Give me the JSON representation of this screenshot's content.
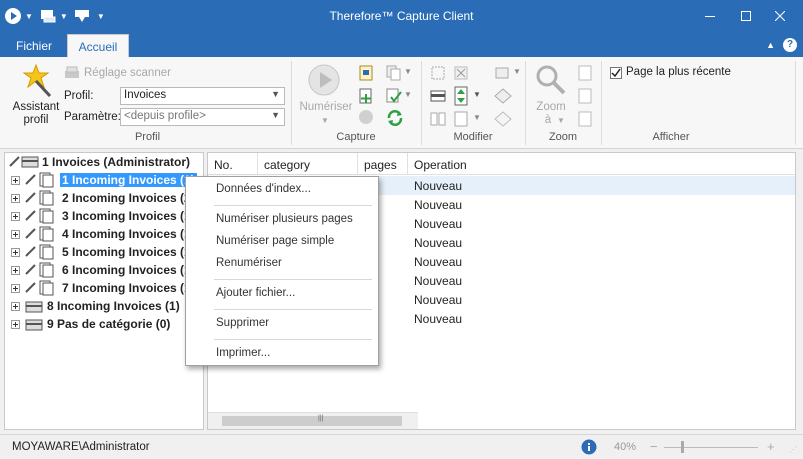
{
  "window": {
    "title": "Therefore™ Capture Client"
  },
  "tabs": [
    {
      "label": "Fichier"
    },
    {
      "label": "Accueil"
    }
  ],
  "ribbon": {
    "assistant_profil": "Assistant profil",
    "reglage_scanner": "Réglage scanner",
    "profil_label": "Profil:",
    "profil_value": "Invoices",
    "parametre_label": "Paramètre:",
    "parametre_value": "<depuis profile>",
    "numeriser": "Numériser",
    "zoom": "Zoom",
    "zoom_a": "à",
    "page_plus_recente": "Page la plus récente",
    "groups": {
      "profil": "Profil",
      "capture": "Capture",
      "modifier": "Modifier",
      "zoom": "Zoom",
      "afficher": "Afficher"
    }
  },
  "tree": {
    "root": "1 Invoices (Administrator)",
    "items": [
      "1 Incoming Invoices (1)",
      "2 Incoming Invoices (2",
      "3 Incoming Invoices (1",
      "4 Incoming Invoices (1",
      "5 Incoming Invoices (1",
      "6 Incoming Invoices (1",
      "7 Incoming Invoices (1",
      "8 Incoming Invoices (1)",
      "9 Pas de catégorie (0)"
    ]
  },
  "grid": {
    "columns": [
      "No.",
      "category",
      "pages",
      "Operation"
    ],
    "operation_values": [
      "Nouveau",
      "Nouveau",
      "Nouveau",
      "Nouveau",
      "Nouveau",
      "Nouveau",
      "Nouveau",
      "Nouveau"
    ]
  },
  "context_menu": {
    "donnees_index": "Données d'index...",
    "numeriser_plusieurs": "Numériser plusieurs pages",
    "numeriser_simple": "Numériser page simple",
    "renumeriser": "Renumériser",
    "ajouter_fichier": "Ajouter fichier...",
    "supprimer": "Supprimer",
    "imprimer": "Imprimer..."
  },
  "status": {
    "user": "MOYAWARE\\Administrator",
    "zoom_level": "40%"
  },
  "colors": {
    "accent": "#2b6cb7",
    "selection": "#3399ff"
  }
}
